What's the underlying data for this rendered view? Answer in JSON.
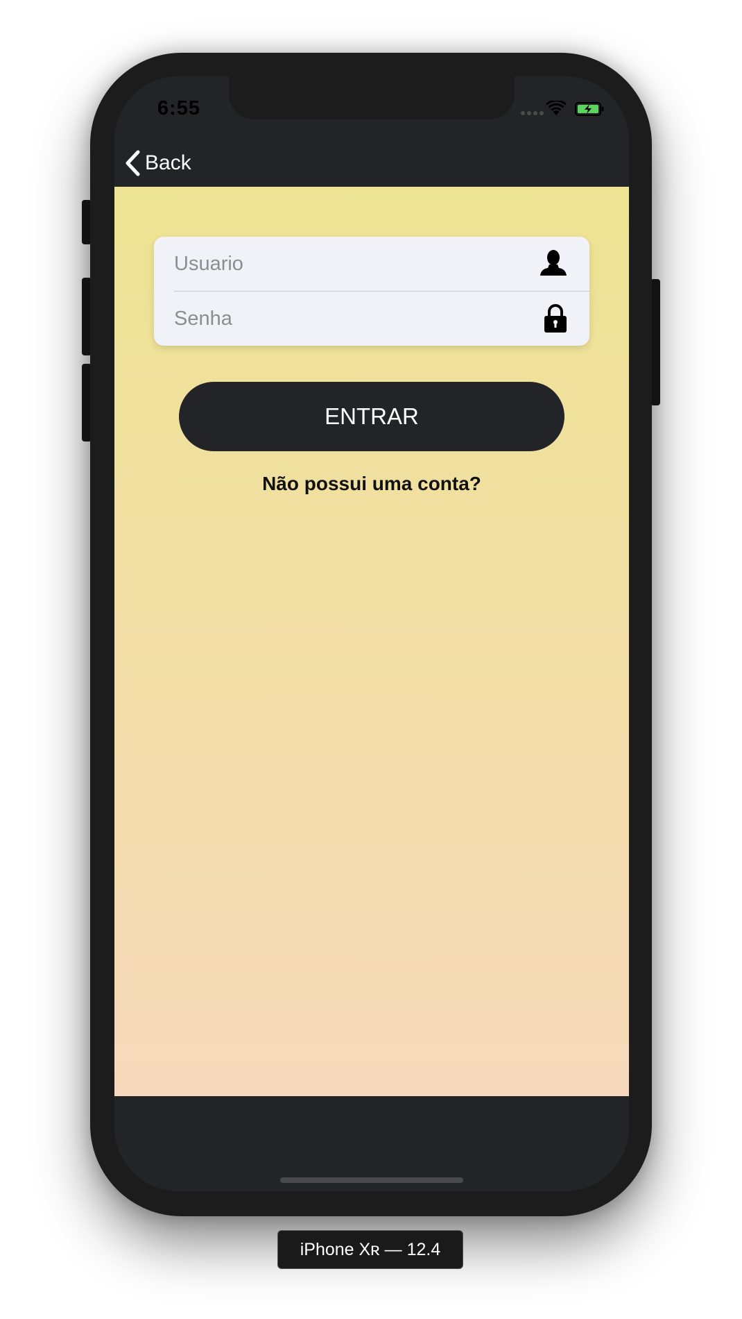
{
  "status_bar": {
    "time": "6:55",
    "icons": [
      "signal-dots-icon",
      "wifi-icon",
      "battery-charging-icon"
    ],
    "battery_color": "#5cd35c"
  },
  "nav": {
    "back_label": "Back",
    "back_icon": "chevron-left-icon"
  },
  "login": {
    "username_placeholder": "Usuario",
    "username_value": "",
    "username_icon": "user-silhouette-icon",
    "password_placeholder": "Senha",
    "password_value": "",
    "password_icon": "lock-icon",
    "enter_label": "ENTRAR",
    "signup_label": "Não possui uma conta?"
  },
  "theme": {
    "gradient_top": "#ede393",
    "gradient_bottom": "#f6d9bb",
    "dark": "#232428",
    "field_background": "#f1f2f7"
  },
  "device_label": "iPhone Xʀ — 12.4"
}
